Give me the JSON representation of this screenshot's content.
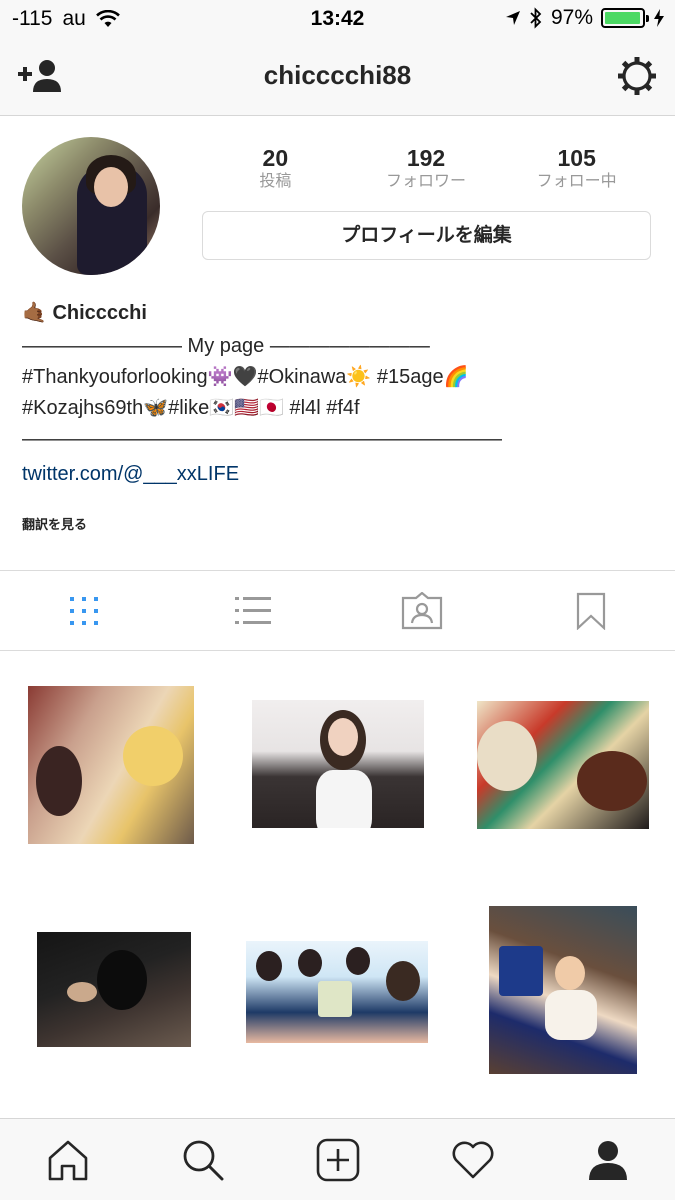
{
  "status_bar": {
    "signal": "-115",
    "carrier": "au",
    "time": "13:42",
    "battery_percent": "97%",
    "battery_level": 0.97,
    "battery_color": "#4cd964"
  },
  "nav": {
    "username": "chicccchi88",
    "left_icon": "add-user-icon",
    "right_icon": "gear-icon"
  },
  "profile": {
    "stats": [
      {
        "value": "20",
        "label": "投稿"
      },
      {
        "value": "192",
        "label": "フォロワー"
      },
      {
        "value": "105",
        "label": "フォロー中"
      }
    ],
    "edit_button": "プロフィールを編集",
    "bio": {
      "name_emoji": "🤙🏾",
      "name": "Chicccchi",
      "line1": "———————— My page ————————",
      "line2": "#Thankyouforlooking👾🖤#Okinawa☀️ #15age🌈",
      "line3": "#Kozajhs69th🦋#like🇰🇷🇺🇸🇯🇵 #l4l #f4f",
      "line4": "————————————————————————"
    },
    "link": "twitter.com/@___xxLIFE",
    "see_translation": "翻訳を見る"
  },
  "view_tabs": [
    {
      "icon": "grid-view-icon",
      "active": true
    },
    {
      "icon": "list-view-icon",
      "active": false
    },
    {
      "icon": "tagged-photos-icon",
      "active": false
    },
    {
      "icon": "bookmark-icon",
      "active": false
    }
  ],
  "colors": {
    "accent": "#3897f0",
    "inactive_icon": "#999999",
    "link": "#003569",
    "border": "#dbdbdb"
  },
  "bottom_nav": [
    {
      "icon": "home-icon"
    },
    {
      "icon": "search-icon"
    },
    {
      "icon": "new-post-icon"
    },
    {
      "icon": "activity-heart-icon"
    },
    {
      "icon": "profile-icon",
      "active": true
    }
  ]
}
